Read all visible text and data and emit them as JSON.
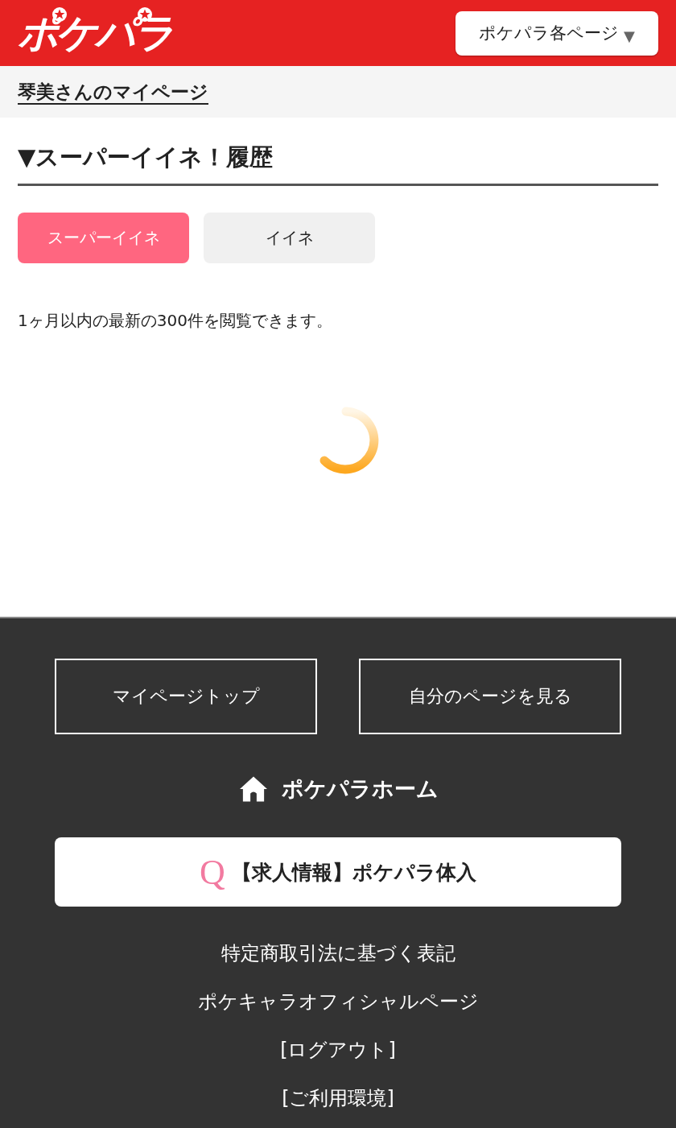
{
  "header": {
    "logo": "ポケパラ",
    "menu_button": {
      "label": "ポケパラ各ページ",
      "caret": "▼"
    }
  },
  "breadcrumb": "琴美さんのマイページ",
  "section": {
    "title": "▼スーパーイイネ！履歴"
  },
  "tabs": [
    {
      "label": "スーパーイイネ",
      "selected": true
    },
    {
      "label": "イイネ",
      "selected": false
    }
  ],
  "notice": "1ヶ月以内の最新の300件を閲覧できます。",
  "loading": true,
  "footer": {
    "buttons": [
      "マイページトップ",
      "自分のページを見る"
    ],
    "home_link": "ポケパラホーム",
    "banner": {
      "mark": "Q",
      "label": "【求人情報】ポケパラ体入"
    },
    "links": [
      "特定商取引法に基づく表記",
      "ポケキャラオフィシャルページ",
      "[ログアウト]",
      "[ご利用環境]"
    ]
  }
}
